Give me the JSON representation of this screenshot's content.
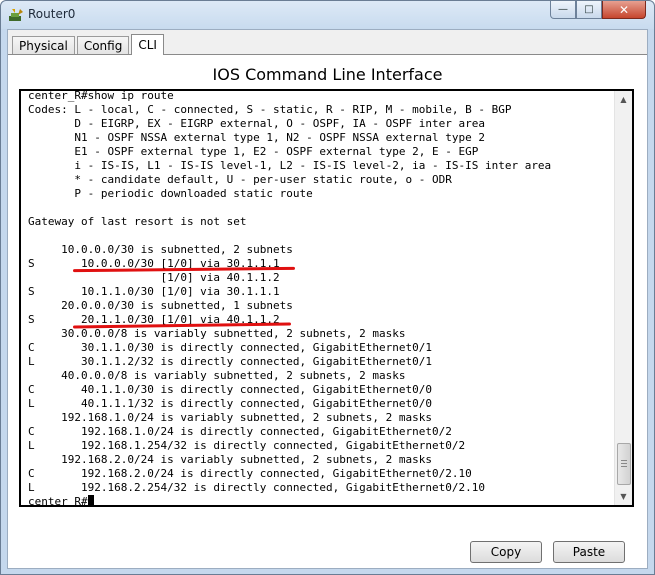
{
  "window": {
    "title": "Router0",
    "buttons": {
      "minimize": "—",
      "maximize": "□",
      "close": "✕"
    }
  },
  "tabs": [
    {
      "label": "Physical",
      "active": false
    },
    {
      "label": "Config",
      "active": false
    },
    {
      "label": "CLI",
      "active": true
    }
  ],
  "panel": {
    "title": "IOS Command Line Interface"
  },
  "terminal": {
    "lines": [
      "center_R#show ip route",
      "Codes: L - local, C - connected, S - static, R - RIP, M - mobile, B - BGP",
      "       D - EIGRP, EX - EIGRP external, O - OSPF, IA - OSPF inter area",
      "       N1 - OSPF NSSA external type 1, N2 - OSPF NSSA external type 2",
      "       E1 - OSPF external type 1, E2 - OSPF external type 2, E - EGP",
      "       i - IS-IS, L1 - IS-IS level-1, L2 - IS-IS level-2, ia - IS-IS inter area",
      "       * - candidate default, U - per-user static route, o - ODR",
      "       P - periodic downloaded static route",
      "",
      "Gateway of last resort is not set",
      "",
      "     10.0.0.0/30 is subnetted, 2 subnets",
      "S       10.0.0.0/30 [1/0] via 30.1.1.1",
      "                    [1/0] via 40.1.1.2",
      "S       10.1.1.0/30 [1/0] via 30.1.1.1",
      "     20.0.0.0/30 is subnetted, 1 subnets",
      "S       20.1.1.0/30 [1/0] via 40.1.1.2",
      "     30.0.0.0/8 is variably subnetted, 2 subnets, 2 masks",
      "C       30.1.1.0/30 is directly connected, GigabitEthernet0/1",
      "L       30.1.1.2/32 is directly connected, GigabitEthernet0/1",
      "     40.0.0.0/8 is variably subnetted, 2 subnets, 2 masks",
      "C       40.1.1.0/30 is directly connected, GigabitEthernet0/0",
      "L       40.1.1.1/32 is directly connected, GigabitEthernet0/0",
      "     192.168.1.0/24 is variably subnetted, 2 subnets, 2 masks",
      "C       192.168.1.0/24 is directly connected, GigabitEthernet0/2",
      "L       192.168.1.254/32 is directly connected, GigabitEthernet0/2",
      "     192.168.2.0/24 is variably subnetted, 2 subnets, 2 masks",
      "C       192.168.2.0/24 is directly connected, GigabitEthernet0/2.10",
      "L       192.168.2.254/32 is directly connected, GigabitEthernet0/2.10"
    ],
    "prompt": "center_R#"
  },
  "buttons": {
    "copy": "Copy",
    "paste": "Paste"
  },
  "colors": {
    "annotation": "#e01010"
  }
}
